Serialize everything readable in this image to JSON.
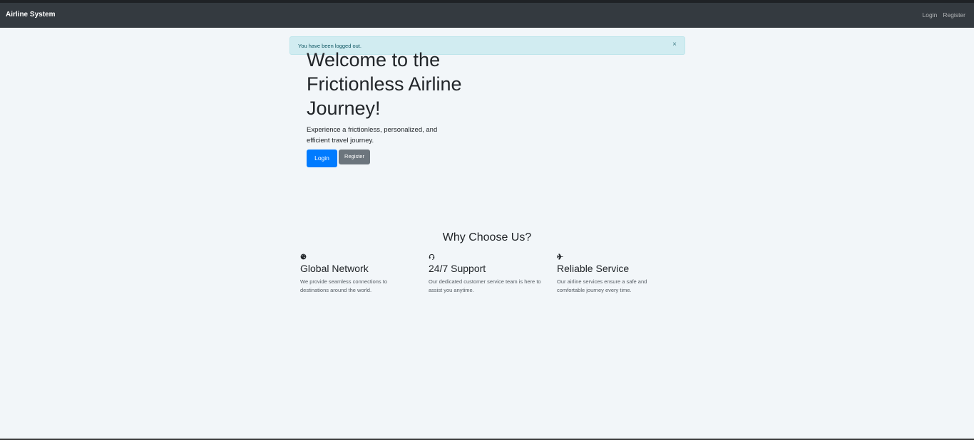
{
  "navbar": {
    "brand": "Airline System",
    "links": [
      {
        "label": "Login"
      },
      {
        "label": "Register"
      }
    ]
  },
  "alert": {
    "message": "You have been logged out.",
    "close_glyph": "×"
  },
  "hero": {
    "title": "Welcome to the Frictionless Airline Journey!",
    "lead": "Experience a frictionless, personalized, and efficient travel journey.",
    "login_label": "Login",
    "register_label": "Register"
  },
  "why": {
    "title": "Why Choose Us?",
    "features": [
      {
        "icon": "globe-icon",
        "title": "Global Network",
        "desc": "We provide seamless connections to destinations around the world."
      },
      {
        "icon": "headset-icon",
        "title": "24/7 Support",
        "desc": "Our dedicated customer service team is here to assist you anytime."
      },
      {
        "icon": "plane-icon",
        "title": "Reliable Service",
        "desc": "Our airline services ensure a safe and comfortable journey every time."
      }
    ]
  },
  "colors": {
    "navbar_bg": "#343a40",
    "page_bg": "#f2f6f9",
    "primary": "#007bff",
    "secondary": "#6c757d",
    "alert_bg": "#d1ecf1"
  }
}
